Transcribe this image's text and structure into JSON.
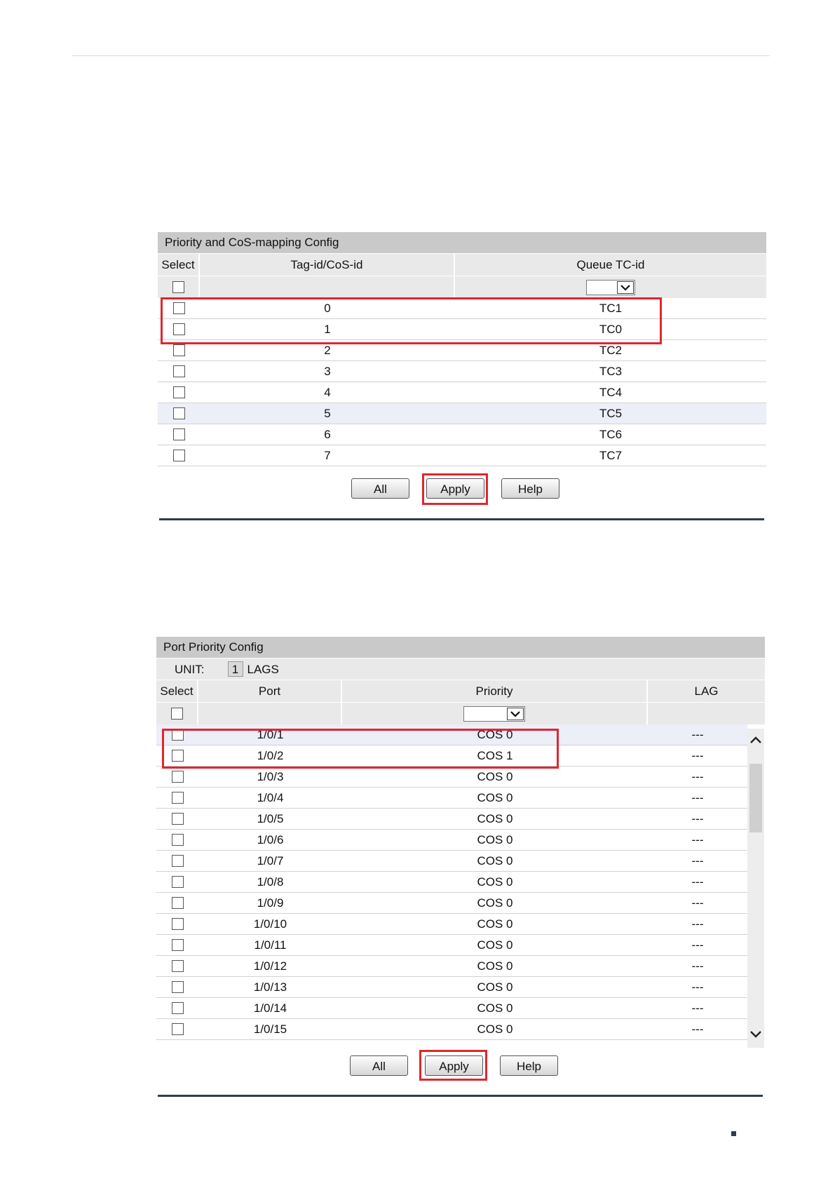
{
  "cos_mapping": {
    "title": "Priority and CoS-mapping Config",
    "columns": [
      "Select",
      "Tag-id/CoS-id",
      "Queue TC-id"
    ],
    "rows": [
      {
        "tag": "0",
        "tc": "TC1"
      },
      {
        "tag": "1",
        "tc": "TC0"
      },
      {
        "tag": "2",
        "tc": "TC2"
      },
      {
        "tag": "3",
        "tc": "TC3"
      },
      {
        "tag": "4",
        "tc": "TC4"
      },
      {
        "tag": "5",
        "tc": "TC5"
      },
      {
        "tag": "6",
        "tc": "TC6"
      },
      {
        "tag": "7",
        "tc": "TC7"
      }
    ],
    "buttons": {
      "all": "All",
      "apply": "Apply",
      "help": "Help"
    }
  },
  "port_priority": {
    "title": "Port Priority Config",
    "unit_label": "UNIT:",
    "unit_value": "1",
    "lags_label": "LAGS",
    "columns": [
      "Select",
      "Port",
      "Priority",
      "LAG"
    ],
    "rows": [
      {
        "port": "1/0/1",
        "priority": "COS 0",
        "lag": "---"
      },
      {
        "port": "1/0/2",
        "priority": "COS 1",
        "lag": "---"
      },
      {
        "port": "1/0/3",
        "priority": "COS 0",
        "lag": "---"
      },
      {
        "port": "1/0/4",
        "priority": "COS 0",
        "lag": "---"
      },
      {
        "port": "1/0/5",
        "priority": "COS 0",
        "lag": "---"
      },
      {
        "port": "1/0/6",
        "priority": "COS 0",
        "lag": "---"
      },
      {
        "port": "1/0/7",
        "priority": "COS 0",
        "lag": "---"
      },
      {
        "port": "1/0/8",
        "priority": "COS 0",
        "lag": "---"
      },
      {
        "port": "1/0/9",
        "priority": "COS 0",
        "lag": "---"
      },
      {
        "port": "1/0/10",
        "priority": "COS 0",
        "lag": "---"
      },
      {
        "port": "1/0/11",
        "priority": "COS 0",
        "lag": "---"
      },
      {
        "port": "1/0/12",
        "priority": "COS 0",
        "lag": "---"
      },
      {
        "port": "1/0/13",
        "priority": "COS 0",
        "lag": "---"
      },
      {
        "port": "1/0/14",
        "priority": "COS 0",
        "lag": "---"
      },
      {
        "port": "1/0/15",
        "priority": "COS 0",
        "lag": "---"
      }
    ],
    "buttons": {
      "all": "All",
      "apply": "Apply",
      "help": "Help"
    }
  },
  "icons": {
    "dropdown_arrow": "chevron-down-icon",
    "scroll_up": "chevron-up-icon",
    "scroll_down": "chevron-down-icon"
  },
  "colors": {
    "highlight_box": "#e0262f",
    "panel_title_bg": "#c9c9c9",
    "header_bg": "#e9e9e9",
    "row_highlight": "#eceef8",
    "rule": "#2f3c4c"
  }
}
